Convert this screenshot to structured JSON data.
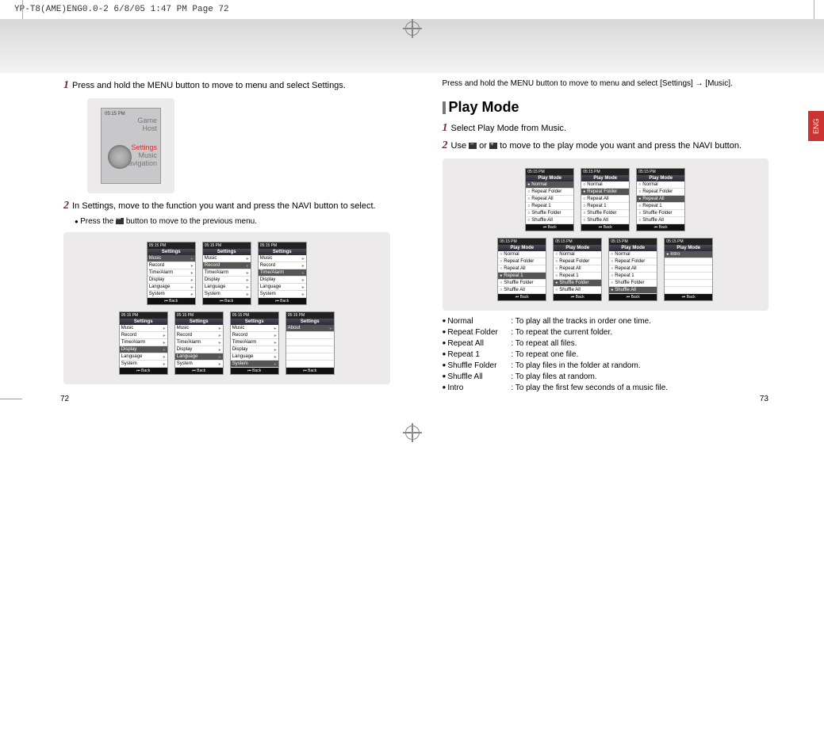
{
  "header_strip": "YP-T8(AME)ENG0.0-2  6/8/05 1:47 PM  Page 72",
  "eng_tab": "ENG",
  "page_left": "72",
  "page_right": "73",
  "left_page": {
    "step1": "Press and hold the MENU button to move to menu and select Settings.",
    "step2": "In Settings, move to the function you want and press the NAVI button to select.",
    "note": "Press the ⏮ button to move to the previous menu.",
    "home_screen": {
      "statusbar": "05:15 PM",
      "items": [
        "Game",
        "Host",
        "Settings",
        "Music",
        "Navigation"
      ]
    },
    "settings_menu": {
      "title": "Settings",
      "items": [
        "Music",
        "Record",
        "Time/Alarm",
        "Display",
        "Language",
        "System"
      ],
      "back": "Back"
    },
    "settings_screens_top_selected": [
      0,
      1,
      2
    ],
    "settings_screens_bot_selected": [
      3,
      4,
      5
    ],
    "about_screen": {
      "title": "Settings",
      "item": "About",
      "back": "Back"
    }
  },
  "right_page": {
    "intro": "Press and hold the MENU button to move to menu and select [Settings] → [Music].",
    "section_title": "Play Mode",
    "step1": "Select Play Mode from Music.",
    "step2_a": "Use ",
    "step2_b": " or ",
    "step2_c": " to move to the play mode you want and press the NAVI button.",
    "playmode_menu": {
      "title": "Play Mode",
      "items": [
        "Normal",
        "Repeat Folder",
        "Repeat All",
        "Repeat 1",
        "Shuffle Folder",
        "Shuffle All"
      ],
      "back": "Back"
    },
    "intro_screen": {
      "title": "Play Mode",
      "item": "Intro",
      "back": "Back"
    },
    "top_selected": [
      0,
      1,
      2
    ],
    "bot_selected": [
      3,
      4,
      5
    ],
    "definitions": [
      {
        "label": "Normal",
        "desc": "To play all the tracks in order one time."
      },
      {
        "label": "Repeat Folder",
        "desc": "To repeat the current folder."
      },
      {
        "label": "Repeat All",
        "desc": "To repeat all files."
      },
      {
        "label": "Repeat 1",
        "desc": "To repeat one file."
      },
      {
        "label": "Shuffle Folder",
        "desc": "To play files in the folder at random."
      },
      {
        "label": "Shuffle All",
        "desc": "To play files at random."
      },
      {
        "label": "Intro",
        "desc": "To play the first few seconds of a music file."
      }
    ]
  }
}
